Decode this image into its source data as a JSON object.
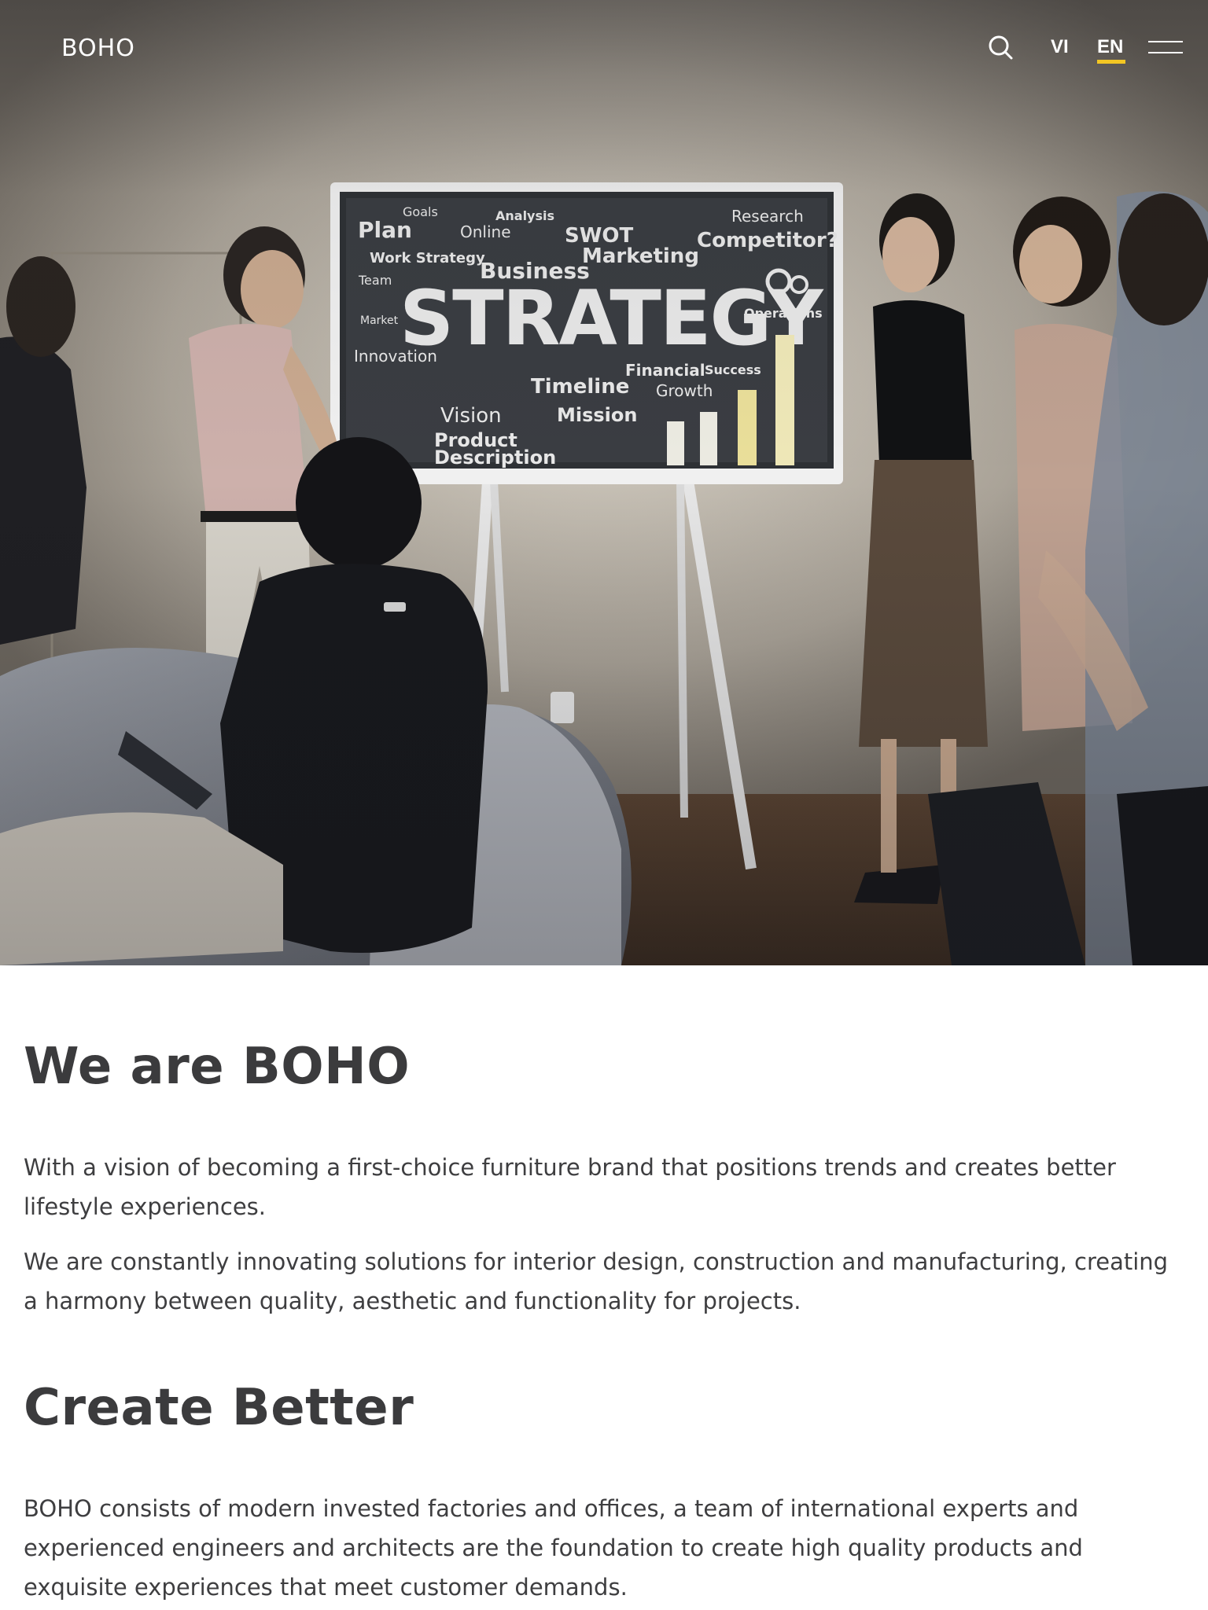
{
  "header": {
    "logo": "BOHO",
    "search_icon": "search-icon",
    "languages": [
      {
        "code": "VI",
        "active": false
      },
      {
        "code": "EN",
        "active": true
      }
    ],
    "menu_icon": "hamburger-menu-icon",
    "accent_color": "#f3c623"
  },
  "hero": {
    "image": "team-meeting-strategy-board-photo",
    "board_words": [
      "Goals",
      "Analysis",
      "Research",
      "Plan",
      "Online",
      "SWOT",
      "Competitor?",
      "Work Strategy",
      "Business",
      "Marketing",
      "Team",
      "STRATEGY",
      "Operations",
      "Market",
      "Innovation",
      "Financial",
      "Success",
      "Timeline",
      "Growth",
      "Vision",
      "Mission",
      "Product",
      "Description"
    ]
  },
  "sections": [
    {
      "title": "We are BOHO",
      "paragraphs": [
        "With a vision of becoming a first-choice furniture brand that positions trends and creates better lifestyle experiences.",
        "We are constantly innovating solutions for interior design, construction and manufacturing, creating a harmony between quality, aesthetic and functionality for projects."
      ]
    },
    {
      "title": "Create Better",
      "paragraphs": [
        "BOHO consists of modern invested factories and offices, a team of international experts and experienced engineers and architects are the foundation to create high quality products and exquisite experiences that meet customer demands."
      ]
    }
  ]
}
